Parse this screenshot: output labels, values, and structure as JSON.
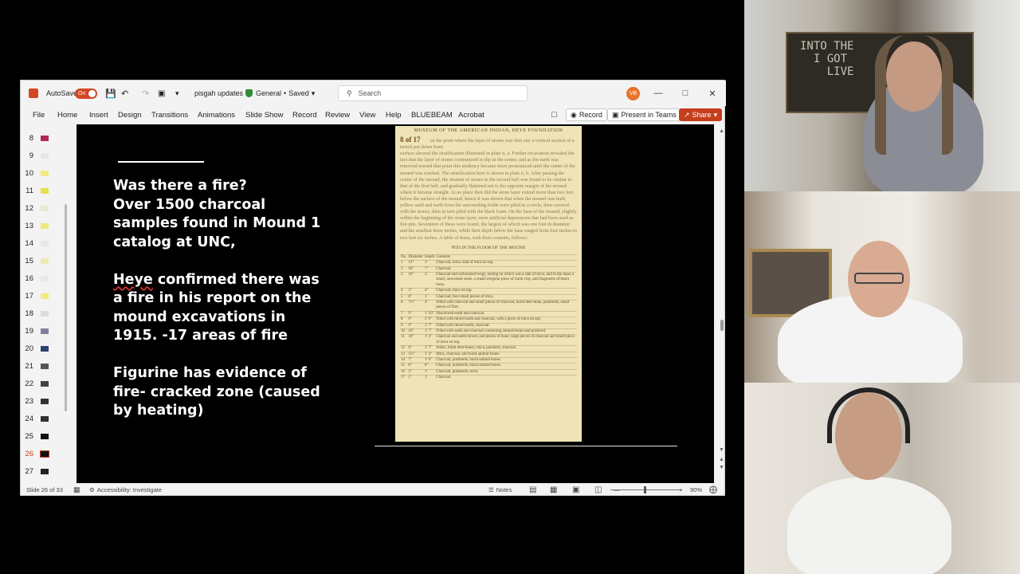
{
  "window": {
    "autosave_label": "AutoSave",
    "autosave_state": "On",
    "filename": "pisgah updates",
    "sensitivity": "General",
    "save_status": "Saved",
    "search_placeholder": "Search",
    "user_initials": "VB"
  },
  "ribbon": {
    "tabs": [
      "File",
      "Home",
      "Insert",
      "Design",
      "Transitions",
      "Animations",
      "Slide Show",
      "Record",
      "Review",
      "View",
      "Help",
      "BLUEBEAM",
      "Acrobat"
    ],
    "record_button": "Record",
    "present_button": "Present in Teams",
    "share_button": "Share"
  },
  "thumbnails": {
    "numbers": [
      "8",
      "9",
      "10",
      "11",
      "12",
      "13",
      "14",
      "15",
      "16",
      "17",
      "18",
      "19",
      "20",
      "21",
      "22",
      "23",
      "24",
      "25",
      "26",
      "27"
    ],
    "active": "26"
  },
  "slide": {
    "para1": [
      "Was there a fire?",
      "Over 1500 charcoal",
      "samples found in Mound 1",
      "catalog at UNC,"
    ],
    "para2_first_word": "Heye",
    "para2_rest": " confirmed there was",
    "para2": [
      "a fire in his report on the",
      "mound excavations in",
      "1915. -17 areas of fire"
    ],
    "para3": [
      "Figurine has evidence of",
      "fire- cracked zone (caused",
      "by heating)"
    ]
  },
  "document": {
    "header": "MUSEUM OF THE AMERICAN INDIAN, HEYE FOUNDATION",
    "page_badge": "8 of 17",
    "table_caption": "PITS IN THE FLOOR OF THE MOUND",
    "table_head": [
      "No.",
      "Diameter",
      "Depth",
      "Contents"
    ]
  },
  "status": {
    "slide_info": "Slide 26 of 33",
    "accessibility": "Accessibility: Investigate",
    "notes": "Notes",
    "zoom": "90%"
  },
  "colors": {
    "accent": "#c43e1c",
    "slide_bg": "#000000",
    "doc_paper": "#efe3b8"
  }
}
